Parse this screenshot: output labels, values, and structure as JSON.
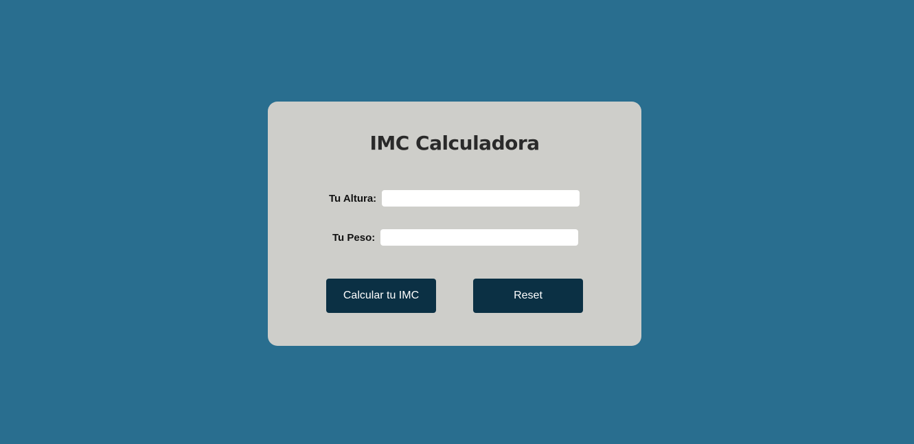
{
  "card": {
    "title": "IMC Calculadora",
    "fields": {
      "altura": {
        "label": "Tu Altura:",
        "value": "",
        "placeholder": ""
      },
      "peso": {
        "label": "Tu Peso:",
        "value": "",
        "placeholder": ""
      }
    },
    "buttons": {
      "calculate_label": "Calcular tu IMC",
      "reset_label": "Reset"
    }
  },
  "colors": {
    "background": "#296e8f",
    "card": "#cececa",
    "button": "#0b3044"
  }
}
